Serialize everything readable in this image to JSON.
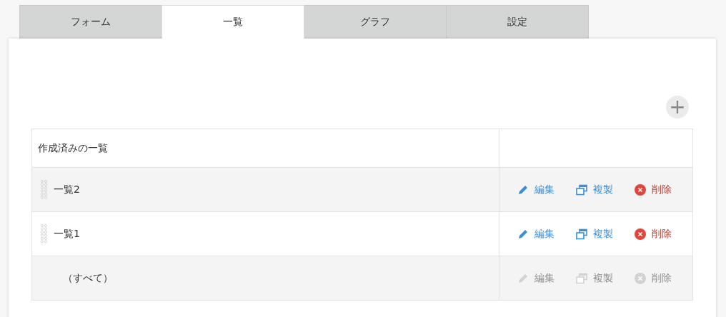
{
  "tabs": [
    {
      "label": "フォーム",
      "selected": false
    },
    {
      "label": "一覧",
      "selected": true
    },
    {
      "label": "グラフ",
      "selected": false
    },
    {
      "label": "設定",
      "selected": false
    }
  ],
  "add_button": {
    "label": "+"
  },
  "table": {
    "columns": [
      "作成済みの一覧"
    ],
    "rows": [
      {
        "name": "一覧2",
        "draggable": true,
        "disabled": false,
        "actions": [
          {
            "kind": "edit",
            "label": "編集"
          },
          {
            "kind": "copy",
            "label": "複製"
          },
          {
            "kind": "delete",
            "label": "削除"
          }
        ]
      },
      {
        "name": "一覧1",
        "draggable": true,
        "disabled": false,
        "actions": [
          {
            "kind": "edit",
            "label": "編集"
          },
          {
            "kind": "copy",
            "label": "複製"
          },
          {
            "kind": "delete",
            "label": "削除"
          }
        ]
      },
      {
        "name": "（すべて）",
        "draggable": false,
        "disabled": true,
        "actions": [
          {
            "kind": "edit",
            "label": "編集"
          },
          {
            "kind": "copy",
            "label": "複製"
          },
          {
            "kind": "delete",
            "label": "削除"
          }
        ]
      }
    ]
  }
}
